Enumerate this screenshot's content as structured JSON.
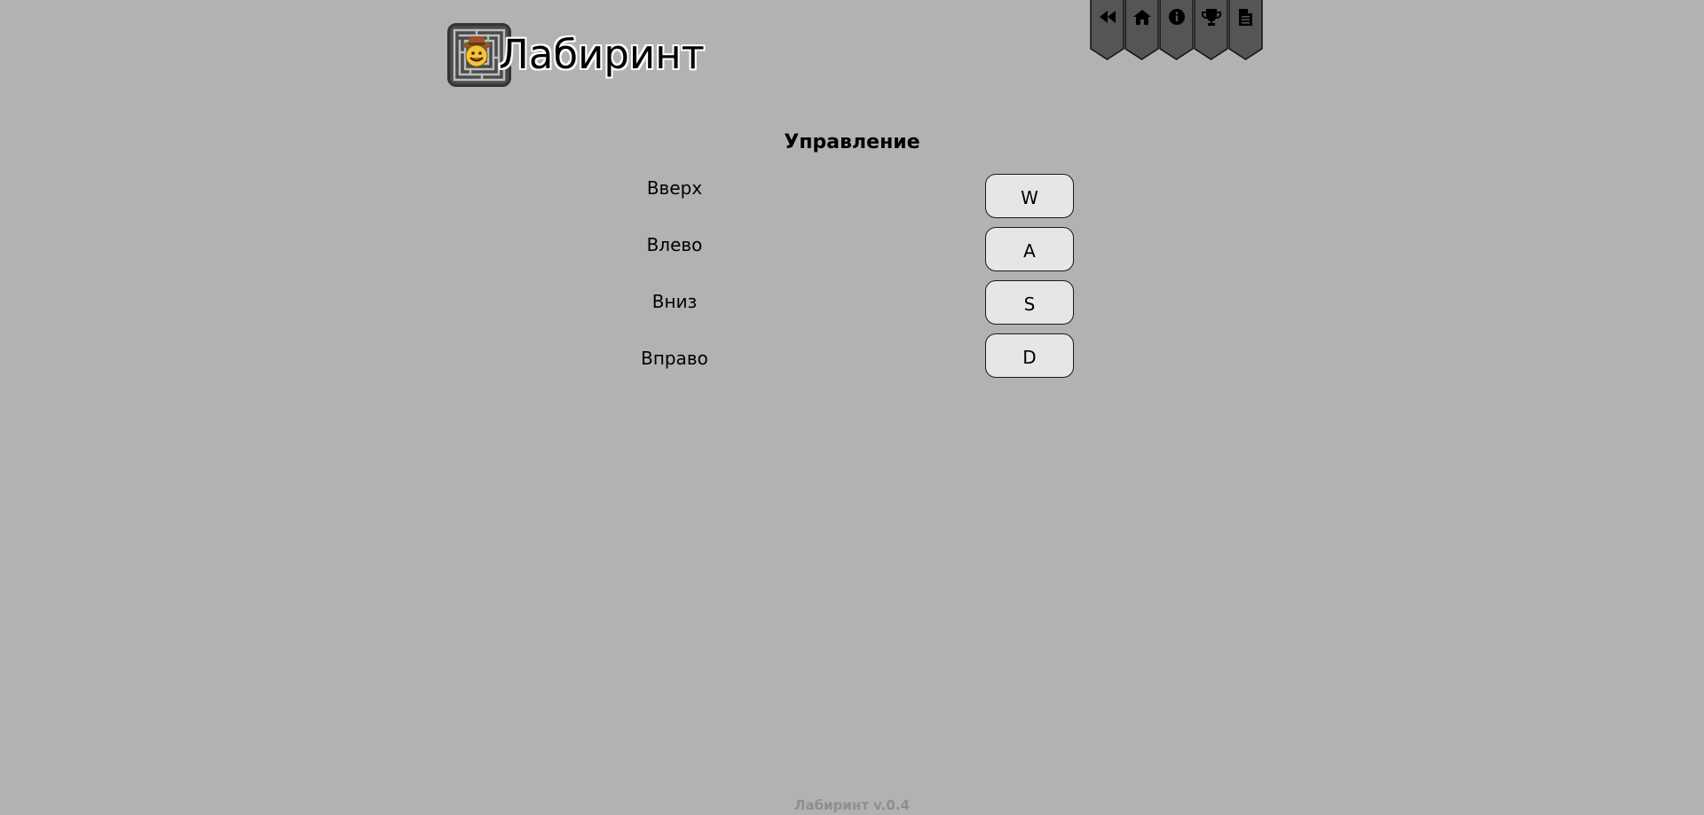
{
  "app": {
    "title": "Лабиринт",
    "version": "Лабиринт v.0.4"
  },
  "nav": [
    {
      "icon": "rewind-icon",
      "name": "back"
    },
    {
      "icon": "home-icon",
      "name": "home"
    },
    {
      "icon": "info-icon",
      "name": "info"
    },
    {
      "icon": "trophy-icon",
      "name": "records"
    },
    {
      "icon": "document-icon",
      "name": "rules"
    }
  ],
  "controls": {
    "title": "Управление",
    "items": [
      {
        "action": "Вверх",
        "key": "W"
      },
      {
        "action": "Влево",
        "key": "A"
      },
      {
        "action": "Вниз",
        "key": "S"
      },
      {
        "action": "Вправо",
        "key": "D"
      }
    ]
  },
  "colors": {
    "background": "#b2b2b2",
    "nav_flag": "#555555",
    "key_button": "#e6e6e6",
    "version_text": "#8f8f8f"
  }
}
